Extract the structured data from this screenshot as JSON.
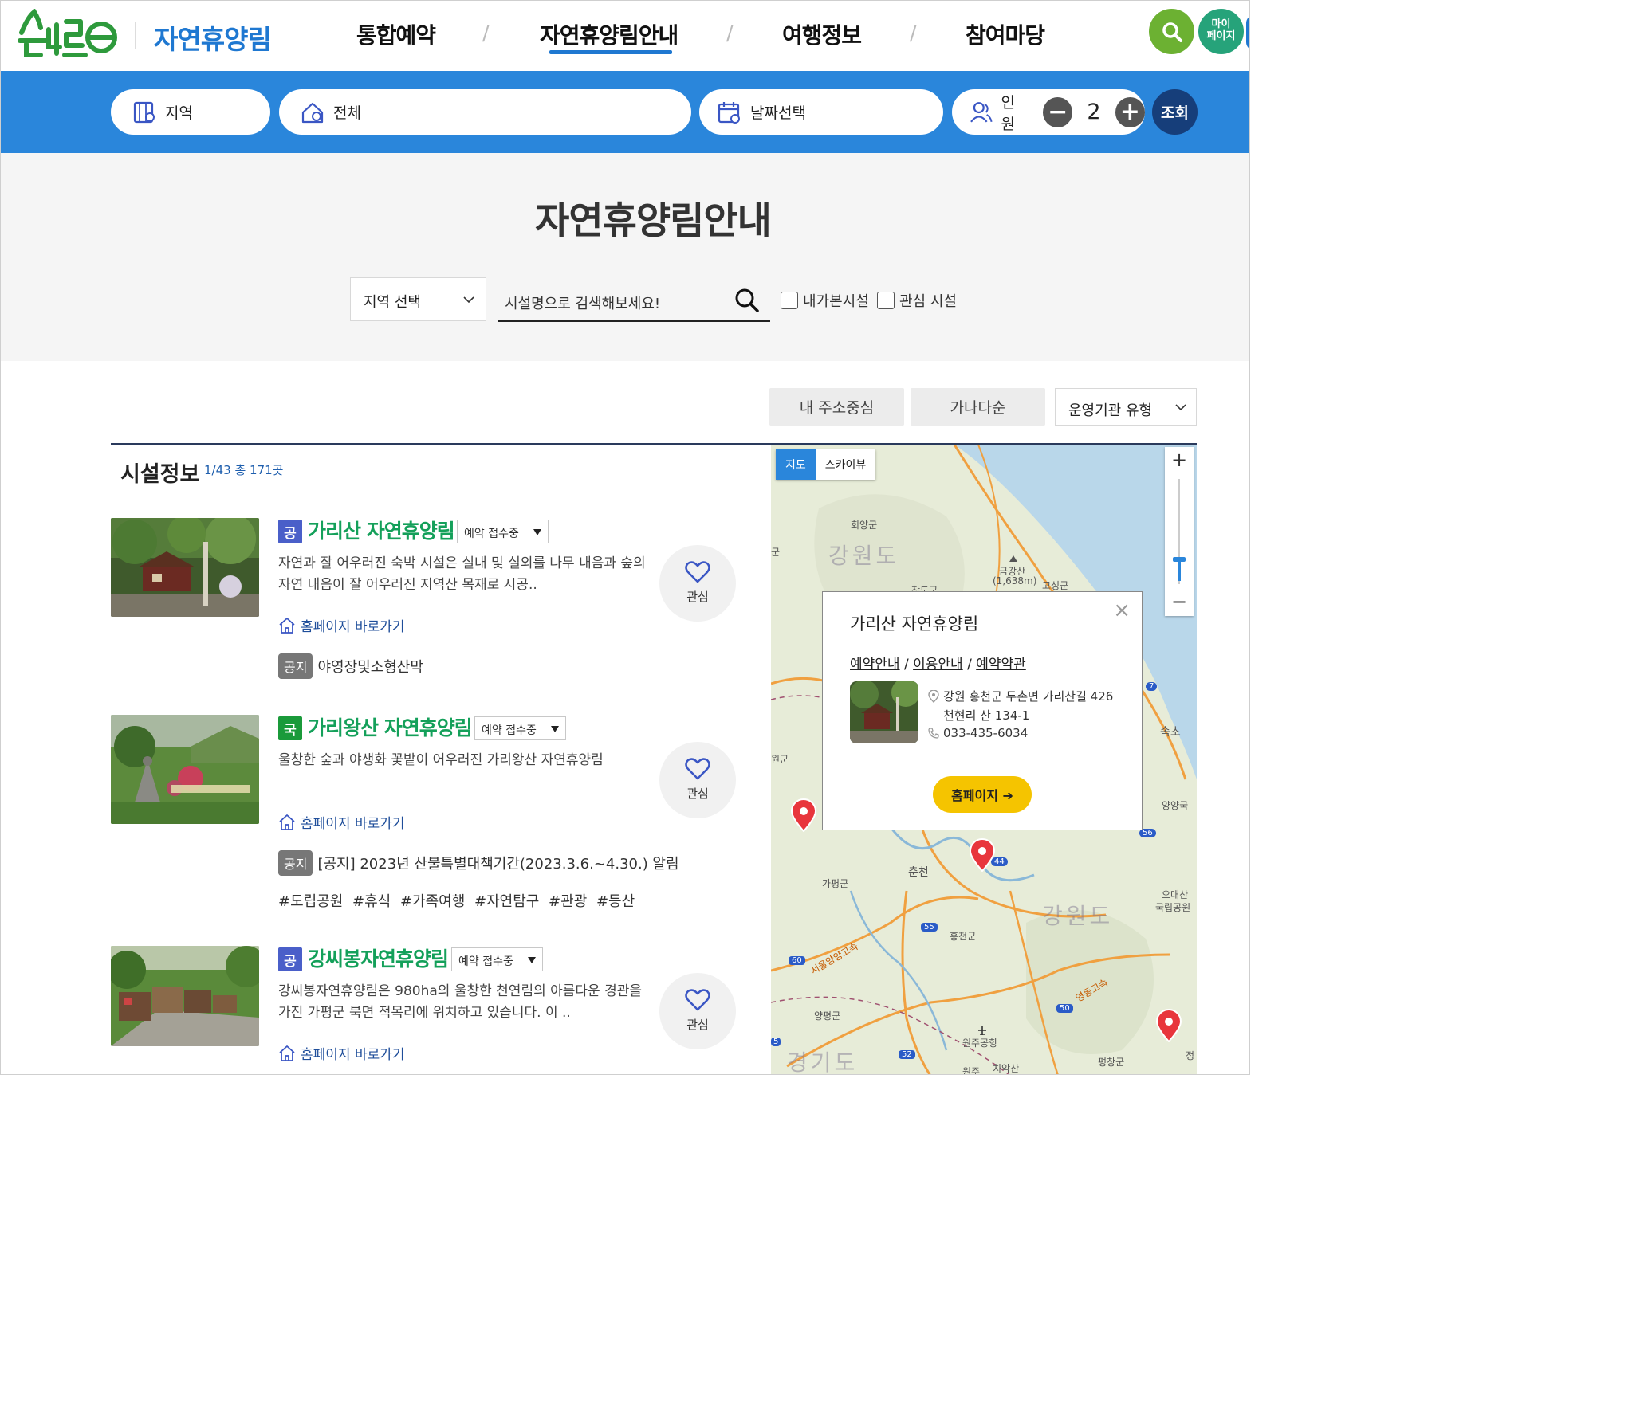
{
  "header": {
    "logo_text": "숲나들e",
    "site_title": "자연휴양림",
    "nav": [
      "통합예약",
      "자연휴양림안내",
      "여행정보",
      "참여마당"
    ],
    "separator": "/",
    "mypage_label_line1": "마이",
    "mypage_label_line2": "페이지"
  },
  "search_bar": {
    "region_label": "지역",
    "facility_label": "전체",
    "date_label": "날짜선택",
    "people_label": "인원",
    "people_count": "2",
    "minus": "−",
    "plus": "+",
    "query_label": "조회"
  },
  "filter": {
    "page_title": "자연휴양림안내",
    "region_select": "지역 선택",
    "search_placeholder": "시설명으로 검색해보세요!",
    "check_visited": "내가본시설",
    "check_interest": "관심 시설"
  },
  "sort": {
    "by_address": "내 주소중심",
    "by_name": "가나다순",
    "operator_type": "운영기관 유형"
  },
  "list": {
    "heading": "시설정보",
    "count": "1/43 총 171곳",
    "fav_label": "관심",
    "homepage_link": "홈페이지 바로가기",
    "notice_tag": "공지",
    "items": [
      {
        "type": "공",
        "type_color": "#4a5fc9",
        "name": "가리산 자연휴양림",
        "status": "예약 접수중",
        "desc": "자연과 잘 어우러진 숙박 시설은 실내 및 실외를 나무 내음과 숲의 자연 내음이 잘 어우러진 지역산 목재로 시공..",
        "notice": "야영장및소형산막",
        "tags": ""
      },
      {
        "type": "국",
        "type_color": "#1a9a3a",
        "name": "가리왕산 자연휴양림",
        "status": "예약 접수중",
        "desc": "울창한 숲과 야생화 꽃밭이 어우러진 가리왕산 자연휴양림",
        "notice": "[공지] 2023년 산불특별대책기간(2023.3.6.~4.30.) 알림",
        "tags": "#도립공원 #휴식 #가족여행 #자연탐구 #관광 #등산"
      },
      {
        "type": "공",
        "type_color": "#4a5fc9",
        "name": "강씨봉자연휴양림",
        "status": "예약 접수중",
        "desc": "강씨봉자연휴양림은 980ha의 울창한 천연림의 아름다운 경관을 가진 가평군 북면 적목리에 위치하고 있습니다. 이 ..",
        "notice": "",
        "tags": ""
      }
    ]
  },
  "map": {
    "tab_map": "지도",
    "tab_skyview": "스카이뷰",
    "zoom_in": "+",
    "zoom_out": "−",
    "labels": {
      "hoeyang": "회양군",
      "gangwon_top": "강원도",
      "geumgang": "금강산",
      "geumgang_height": "(1,638m)",
      "goseong": "고성군",
      "sokcho": "속초",
      "yangyang": "양양국",
      "chuncheon": "춘천",
      "gapyeong": "가평군",
      "hongcheon": "홍천군",
      "gangwon_bottom": "강원도",
      "odaesan_1": "오대산",
      "odaesan_2": "국립공원",
      "yangpyeong": "양평군",
      "wonju_airport": "원주공항",
      "pyeongchang": "평창군",
      "chiaksan": "치악산",
      "gyeonggi": "경기도",
      "wonju": "원주",
      "left_gun": "군",
      "left_wongun": "원군",
      "chanagun": "창도군",
      "seoul_yangyang": "서울양양고속",
      "yeongdong": "영동고속",
      "jeong": "정"
    },
    "routes": [
      "7",
      "56",
      "44",
      "55",
      "60",
      "50",
      "52",
      "5"
    ],
    "popup": {
      "title": "가리산 자연휴양림",
      "link_reserve": "예약안내",
      "link_use": "이용안내",
      "link_terms": "예약약관",
      "link_sep": " / ",
      "address": "강원 홍천군 두촌면 가리산길 426",
      "address2": "천현리 산 134-1",
      "phone": "033-435-6034",
      "homepage_btn": "홈페이지 ➔",
      "close": "×"
    }
  },
  "colors": {
    "primary_blue": "#2a86db",
    "nav_blue": "#1f78d1",
    "green_name": "#14a05a",
    "search_green": "#6cb132",
    "mypage_green": "#26a37a",
    "query_navy": "#163e7a",
    "popup_yellow": "#f5c400"
  }
}
